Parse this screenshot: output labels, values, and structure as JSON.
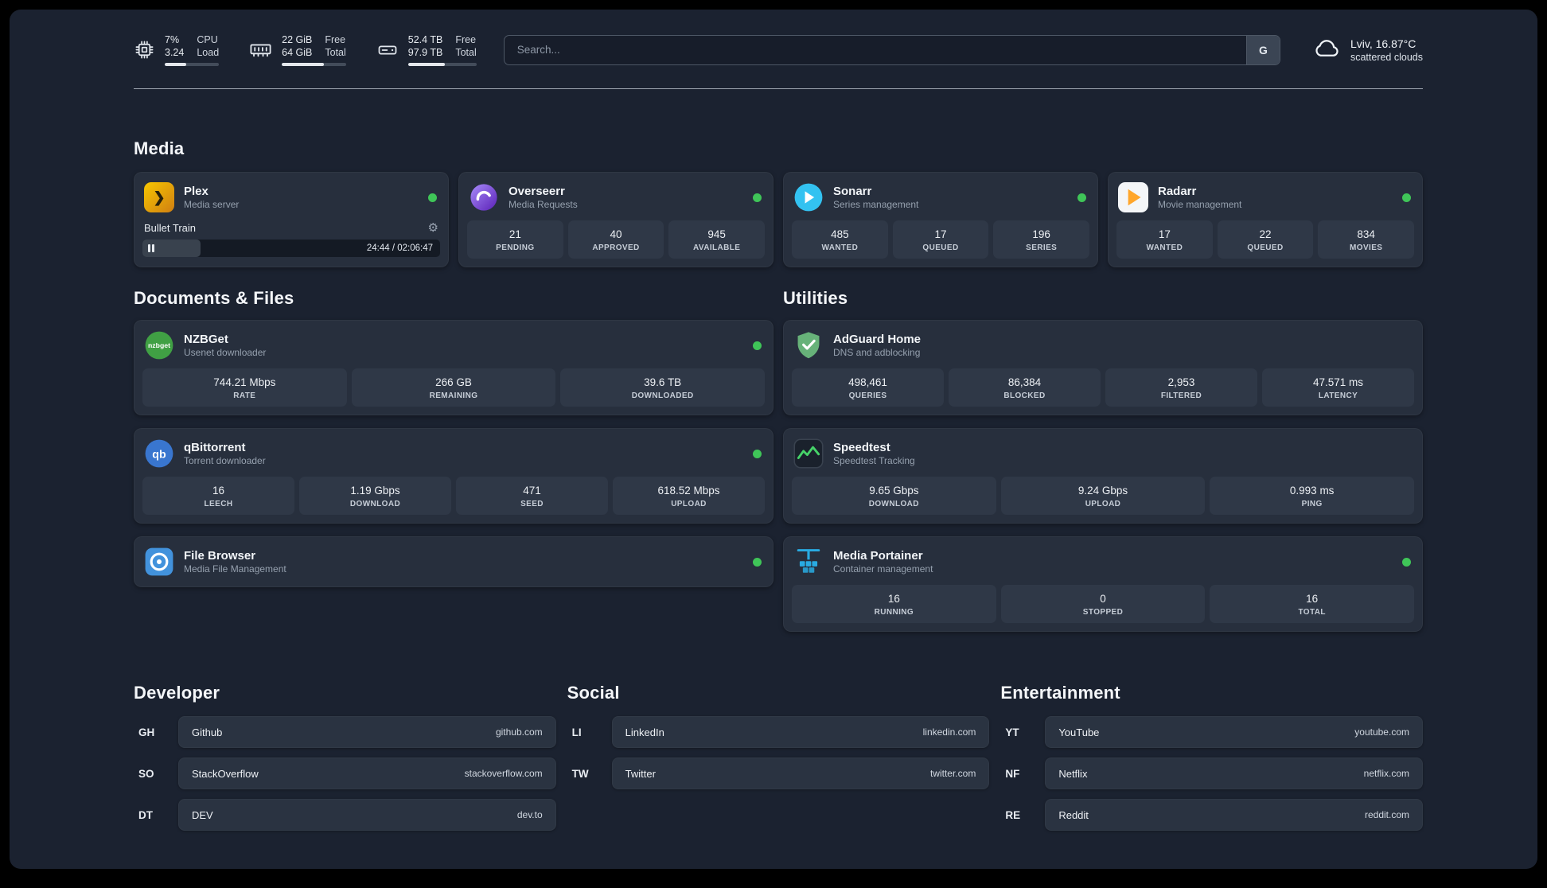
{
  "topbar": {
    "cpu": {
      "value_top": "7%",
      "value_bottom": "3.24",
      "label_top": "CPU",
      "label_bottom": "Load",
      "bar_percent": 40
    },
    "ram": {
      "value_top": "22 GiB",
      "value_bottom": "64 GiB",
      "label_top": "Free",
      "label_bottom": "Total",
      "bar_percent": 65
    },
    "disk": {
      "value_top": "52.4 TB",
      "value_bottom": "97.9 TB",
      "label_top": "Free",
      "label_bottom": "Total",
      "bar_percent": 54
    },
    "search": {
      "placeholder": "Search...",
      "engine_label": "G"
    },
    "weather": {
      "location": "Lviv, 16.87°C",
      "condition": "scattered clouds"
    }
  },
  "sections": {
    "media": {
      "title": "Media"
    },
    "documents": {
      "title": "Documents & Files"
    },
    "utilities": {
      "title": "Utilities"
    }
  },
  "apps": {
    "plex": {
      "name": "Plex",
      "subtitle": "Media server",
      "player": {
        "title": "Bullet Train",
        "time": "24:44 / 02:06:47",
        "progress_percent": 19.5
      }
    },
    "overseerr": {
      "name": "Overseerr",
      "subtitle": "Media Requests",
      "stats": [
        {
          "value": "21",
          "label": "PENDING"
        },
        {
          "value": "40",
          "label": "APPROVED"
        },
        {
          "value": "945",
          "label": "AVAILABLE"
        }
      ]
    },
    "sonarr": {
      "name": "Sonarr",
      "subtitle": "Series management",
      "stats": [
        {
          "value": "485",
          "label": "WANTED"
        },
        {
          "value": "17",
          "label": "QUEUED"
        },
        {
          "value": "196",
          "label": "SERIES"
        }
      ]
    },
    "radarr": {
      "name": "Radarr",
      "subtitle": "Movie management",
      "stats": [
        {
          "value": "17",
          "label": "WANTED"
        },
        {
          "value": "22",
          "label": "QUEUED"
        },
        {
          "value": "834",
          "label": "MOVIES"
        }
      ]
    },
    "nzbget": {
      "name": "NZBGet",
      "subtitle": "Usenet downloader",
      "stats": [
        {
          "value": "744.21 Mbps",
          "label": "RATE"
        },
        {
          "value": "266 GB",
          "label": "REMAINING"
        },
        {
          "value": "39.6 TB",
          "label": "DOWNLOADED"
        }
      ]
    },
    "qbittorrent": {
      "name": "qBittorrent",
      "subtitle": "Torrent downloader",
      "stats": [
        {
          "value": "16",
          "label": "LEECH"
        },
        {
          "value": "1.19 Gbps",
          "label": "DOWNLOAD"
        },
        {
          "value": "471",
          "label": "SEED"
        },
        {
          "value": "618.52 Mbps",
          "label": "UPLOAD"
        }
      ]
    },
    "filebrowser": {
      "name": "File Browser",
      "subtitle": "Media File Management"
    },
    "adguard": {
      "name": "AdGuard Home",
      "subtitle": "DNS and adblocking",
      "stats": [
        {
          "value": "498,461",
          "label": "QUERIES"
        },
        {
          "value": "86,384",
          "label": "BLOCKED"
        },
        {
          "value": "2,953",
          "label": "FILTERED"
        },
        {
          "value": "47.571 ms",
          "label": "LATENCY"
        }
      ]
    },
    "speedtest": {
      "name": "Speedtest",
      "subtitle": "Speedtest Tracking",
      "stats": [
        {
          "value": "9.65 Gbps",
          "label": "DOWNLOAD"
        },
        {
          "value": "9.24 Gbps",
          "label": "UPLOAD"
        },
        {
          "value": "0.993 ms",
          "label": "PING"
        }
      ]
    },
    "portainer": {
      "name": "Media Portainer",
      "subtitle": "Container management",
      "stats": [
        {
          "value": "16",
          "label": "RUNNING"
        },
        {
          "value": "0",
          "label": "STOPPED"
        },
        {
          "value": "16",
          "label": "TOTAL"
        }
      ]
    }
  },
  "bookmarks": {
    "developer": {
      "title": "Developer",
      "items": [
        {
          "abbr": "GH",
          "name": "Github",
          "url": "github.com"
        },
        {
          "abbr": "SO",
          "name": "StackOverflow",
          "url": "stackoverflow.com"
        },
        {
          "abbr": "DT",
          "name": "DEV",
          "url": "dev.to"
        }
      ]
    },
    "social": {
      "title": "Social",
      "items": [
        {
          "abbr": "LI",
          "name": "LinkedIn",
          "url": "linkedin.com"
        },
        {
          "abbr": "TW",
          "name": "Twitter",
          "url": "twitter.com"
        }
      ]
    },
    "entertainment": {
      "title": "Entertainment",
      "items": [
        {
          "abbr": "YT",
          "name": "YouTube",
          "url": "youtube.com"
        },
        {
          "abbr": "NF",
          "name": "Netflix",
          "url": "netflix.com"
        },
        {
          "abbr": "RE",
          "name": "Reddit",
          "url": "reddit.com"
        }
      ]
    }
  },
  "icons": {
    "gear": "⚙",
    "plex_chevron": "❯"
  },
  "colors": {
    "status_online": "#3fc558",
    "page_bg": "#1b2230",
    "card_bg": "#272f3d",
    "tile_bg": "#2f3847",
    "plex": "#e5a00d",
    "overseerr": "#7b74f0",
    "sonarr": "#33c2f1",
    "radarr": "#ffa62b",
    "nzbget": "#40a044",
    "qbittorrent": "#3976cf",
    "adguard": "#67b279",
    "speedtest_accent": "#46d369",
    "filebrowser": "#4292dc",
    "portainer": "#29abe2"
  }
}
